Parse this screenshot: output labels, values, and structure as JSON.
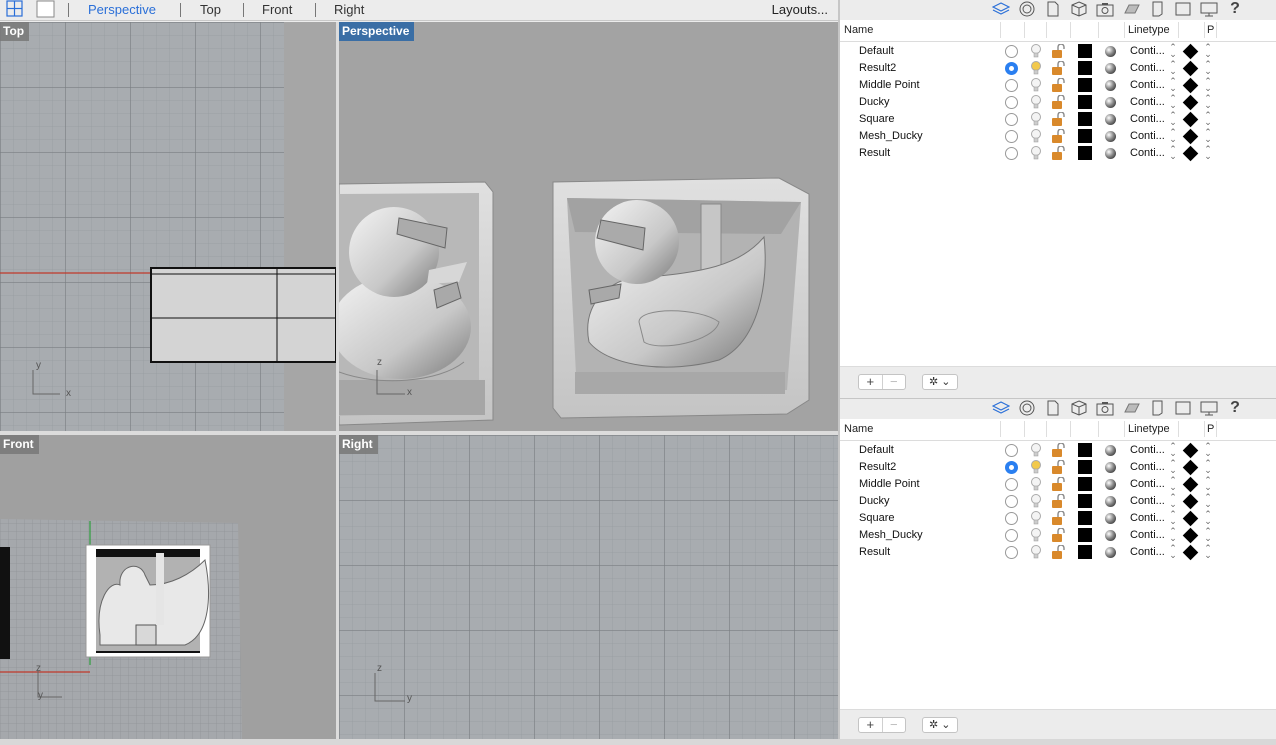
{
  "viewbar": {
    "tabs": [
      "Perspective",
      "Top",
      "Front",
      "Right"
    ],
    "active_tab": "Perspective",
    "layouts_label": "Layouts..."
  },
  "viewports": {
    "top": {
      "label": "Top",
      "axis_y": "y",
      "axis_x": "x"
    },
    "perspective": {
      "label": "Perspective",
      "axis_z": "z",
      "axis_x": "x"
    },
    "front": {
      "label": "Front",
      "axis_z": "z",
      "axis_y": "y"
    },
    "right": {
      "label": "Right",
      "axis_z": "z",
      "axis_y": "y"
    }
  },
  "layer_panel": {
    "toolbar_icons": [
      "layers-icon",
      "material-icon",
      "document-icon",
      "object-icon",
      "camera-icon",
      "grid-icon",
      "notes-icon",
      "viewport-icon",
      "display-icon",
      "help-icon"
    ],
    "columns": {
      "name": "Name",
      "linetype": "Linetype",
      "print": "P"
    },
    "layers": [
      {
        "name": "Default",
        "current": false,
        "on": true,
        "linetype": "Conti..."
      },
      {
        "name": "Result2",
        "current": true,
        "on": true,
        "linetype": "Conti..."
      },
      {
        "name": "Middle Point",
        "current": false,
        "on": true,
        "linetype": "Conti..."
      },
      {
        "name": "Ducky",
        "current": false,
        "on": true,
        "linetype": "Conti..."
      },
      {
        "name": "Square",
        "current": false,
        "on": true,
        "linetype": "Conti..."
      },
      {
        "name": "Mesh_Ducky",
        "current": false,
        "on": true,
        "linetype": "Conti..."
      },
      {
        "name": "Result",
        "current": false,
        "on": true,
        "linetype": "Conti..."
      }
    ],
    "add_label": "+",
    "remove_label": "−",
    "gear_label": "✲ ⌄"
  },
  "colors": {
    "accent": "#2a6fd8",
    "active_viewport_label": "#3a6ea5",
    "x_axis": "#c0392b",
    "y_axis": "#2e9e3e"
  }
}
